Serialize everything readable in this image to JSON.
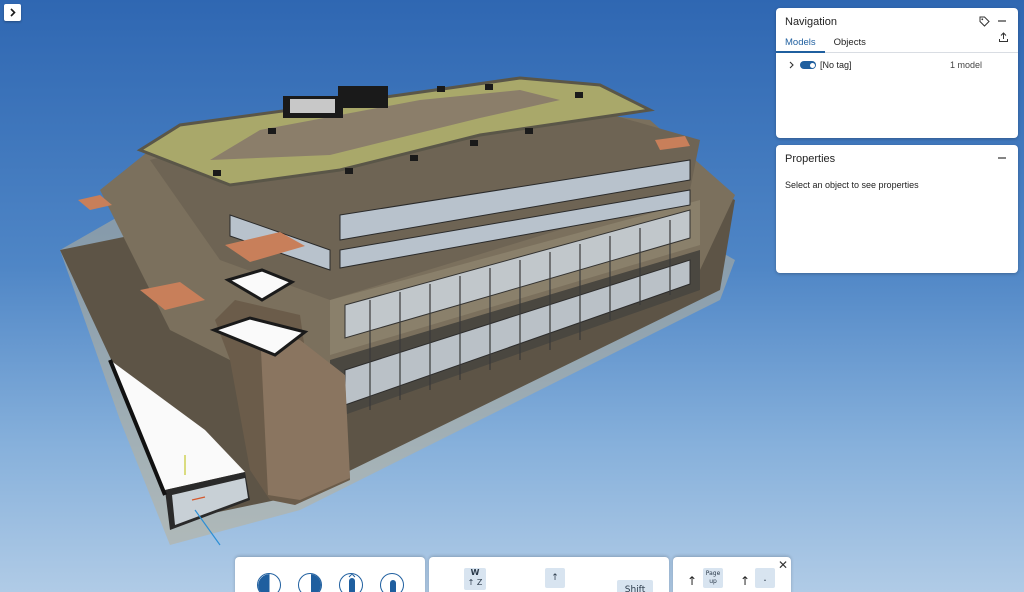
{
  "navigation": {
    "title": "Navigation",
    "tabs": [
      {
        "label": "Models"
      },
      {
        "label": "Objects"
      }
    ],
    "tree": [
      {
        "label": "[No tag]",
        "count": "1 model",
        "visible": true
      }
    ]
  },
  "properties": {
    "title": "Properties",
    "empty_text": "Select an object to see properties"
  },
  "toolbar": {
    "keys": {
      "w": "W",
      "z_arrow": "↑",
      "z": "Z",
      "up": "↑",
      "shift": "Shift",
      "page_up_line1": "Page",
      "page_up_line2": "up",
      "period": "."
    },
    "arrow": "↑"
  },
  "colors": {
    "accent": "#1f5f9f",
    "sky_top": "#2f67b2",
    "sky_bottom": "#b0cbe6",
    "roof": "#a9a86a",
    "facade": "#7b705d"
  }
}
